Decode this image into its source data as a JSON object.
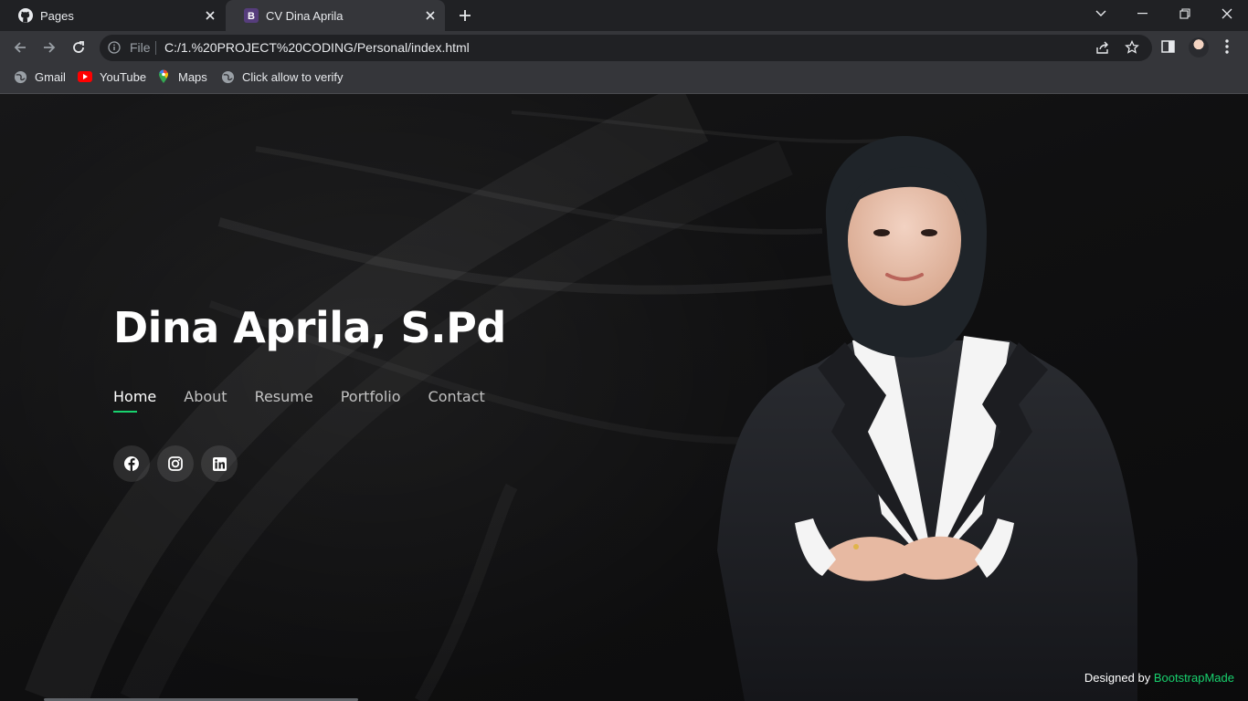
{
  "browser": {
    "tabs": [
      {
        "title": "Pages",
        "icon": "github-icon",
        "active": false
      },
      {
        "title": "CV Dina Aprila",
        "icon": "bootstrap-icon",
        "icon_letter": "B",
        "active": true
      }
    ],
    "omnibox": {
      "scheme_label": "File",
      "url": "C:/1.%20PROJECT%20CODING/Personal/index.html"
    },
    "bookmarks": [
      {
        "label": "Gmail",
        "icon": "globe-icon"
      },
      {
        "label": "YouTube",
        "icon": "youtube-icon"
      },
      {
        "label": "Maps",
        "icon": "maps-pin-icon"
      },
      {
        "label": "Click allow to verify",
        "icon": "globe-icon"
      }
    ],
    "colors": {
      "tabstrip": "#202124",
      "toolbar": "#35363a",
      "omnibox": "#202124"
    }
  },
  "page": {
    "name": "Dina Aprila, S.Pd",
    "nav": [
      {
        "label": "Home",
        "active": true
      },
      {
        "label": "About",
        "active": false
      },
      {
        "label": "Resume",
        "active": false
      },
      {
        "label": "Portfolio",
        "active": false
      },
      {
        "label": "Contact",
        "active": false
      }
    ],
    "socials": [
      "facebook-icon",
      "instagram-icon",
      "linkedin-icon"
    ],
    "credits": {
      "prefix": "Designed by",
      "brand": "BootstrapMade"
    },
    "colors": {
      "accent": "#18d26e",
      "background": "#0f0f10"
    }
  }
}
